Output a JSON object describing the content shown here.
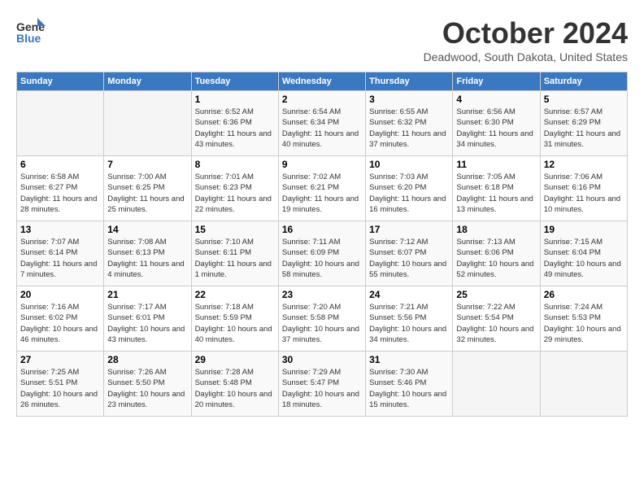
{
  "header": {
    "logo_line1": "General",
    "logo_line2": "Blue",
    "month": "October 2024",
    "location": "Deadwood, South Dakota, United States"
  },
  "weekdays": [
    "Sunday",
    "Monday",
    "Tuesday",
    "Wednesday",
    "Thursday",
    "Friday",
    "Saturday"
  ],
  "weeks": [
    [
      {
        "day": "",
        "empty": true
      },
      {
        "day": "",
        "empty": true
      },
      {
        "day": "1",
        "sunrise": "Sunrise: 6:52 AM",
        "sunset": "Sunset: 6:36 PM",
        "daylight": "Daylight: 11 hours and 43 minutes."
      },
      {
        "day": "2",
        "sunrise": "Sunrise: 6:54 AM",
        "sunset": "Sunset: 6:34 PM",
        "daylight": "Daylight: 11 hours and 40 minutes."
      },
      {
        "day": "3",
        "sunrise": "Sunrise: 6:55 AM",
        "sunset": "Sunset: 6:32 PM",
        "daylight": "Daylight: 11 hours and 37 minutes."
      },
      {
        "day": "4",
        "sunrise": "Sunrise: 6:56 AM",
        "sunset": "Sunset: 6:30 PM",
        "daylight": "Daylight: 11 hours and 34 minutes."
      },
      {
        "day": "5",
        "sunrise": "Sunrise: 6:57 AM",
        "sunset": "Sunset: 6:29 PM",
        "daylight": "Daylight: 11 hours and 31 minutes."
      }
    ],
    [
      {
        "day": "6",
        "sunrise": "Sunrise: 6:58 AM",
        "sunset": "Sunset: 6:27 PM",
        "daylight": "Daylight: 11 hours and 28 minutes."
      },
      {
        "day": "7",
        "sunrise": "Sunrise: 7:00 AM",
        "sunset": "Sunset: 6:25 PM",
        "daylight": "Daylight: 11 hours and 25 minutes."
      },
      {
        "day": "8",
        "sunrise": "Sunrise: 7:01 AM",
        "sunset": "Sunset: 6:23 PM",
        "daylight": "Daylight: 11 hours and 22 minutes."
      },
      {
        "day": "9",
        "sunrise": "Sunrise: 7:02 AM",
        "sunset": "Sunset: 6:21 PM",
        "daylight": "Daylight: 11 hours and 19 minutes."
      },
      {
        "day": "10",
        "sunrise": "Sunrise: 7:03 AM",
        "sunset": "Sunset: 6:20 PM",
        "daylight": "Daylight: 11 hours and 16 minutes."
      },
      {
        "day": "11",
        "sunrise": "Sunrise: 7:05 AM",
        "sunset": "Sunset: 6:18 PM",
        "daylight": "Daylight: 11 hours and 13 minutes."
      },
      {
        "day": "12",
        "sunrise": "Sunrise: 7:06 AM",
        "sunset": "Sunset: 6:16 PM",
        "daylight": "Daylight: 11 hours and 10 minutes."
      }
    ],
    [
      {
        "day": "13",
        "sunrise": "Sunrise: 7:07 AM",
        "sunset": "Sunset: 6:14 PM",
        "daylight": "Daylight: 11 hours and 7 minutes."
      },
      {
        "day": "14",
        "sunrise": "Sunrise: 7:08 AM",
        "sunset": "Sunset: 6:13 PM",
        "daylight": "Daylight: 11 hours and 4 minutes."
      },
      {
        "day": "15",
        "sunrise": "Sunrise: 7:10 AM",
        "sunset": "Sunset: 6:11 PM",
        "daylight": "Daylight: 11 hours and 1 minute."
      },
      {
        "day": "16",
        "sunrise": "Sunrise: 7:11 AM",
        "sunset": "Sunset: 6:09 PM",
        "daylight": "Daylight: 10 hours and 58 minutes."
      },
      {
        "day": "17",
        "sunrise": "Sunrise: 7:12 AM",
        "sunset": "Sunset: 6:07 PM",
        "daylight": "Daylight: 10 hours and 55 minutes."
      },
      {
        "day": "18",
        "sunrise": "Sunrise: 7:13 AM",
        "sunset": "Sunset: 6:06 PM",
        "daylight": "Daylight: 10 hours and 52 minutes."
      },
      {
        "day": "19",
        "sunrise": "Sunrise: 7:15 AM",
        "sunset": "Sunset: 6:04 PM",
        "daylight": "Daylight: 10 hours and 49 minutes."
      }
    ],
    [
      {
        "day": "20",
        "sunrise": "Sunrise: 7:16 AM",
        "sunset": "Sunset: 6:02 PM",
        "daylight": "Daylight: 10 hours and 46 minutes."
      },
      {
        "day": "21",
        "sunrise": "Sunrise: 7:17 AM",
        "sunset": "Sunset: 6:01 PM",
        "daylight": "Daylight: 10 hours and 43 minutes."
      },
      {
        "day": "22",
        "sunrise": "Sunrise: 7:18 AM",
        "sunset": "Sunset: 5:59 PM",
        "daylight": "Daylight: 10 hours and 40 minutes."
      },
      {
        "day": "23",
        "sunrise": "Sunrise: 7:20 AM",
        "sunset": "Sunset: 5:58 PM",
        "daylight": "Daylight: 10 hours and 37 minutes."
      },
      {
        "day": "24",
        "sunrise": "Sunrise: 7:21 AM",
        "sunset": "Sunset: 5:56 PM",
        "daylight": "Daylight: 10 hours and 34 minutes."
      },
      {
        "day": "25",
        "sunrise": "Sunrise: 7:22 AM",
        "sunset": "Sunset: 5:54 PM",
        "daylight": "Daylight: 10 hours and 32 minutes."
      },
      {
        "day": "26",
        "sunrise": "Sunrise: 7:24 AM",
        "sunset": "Sunset: 5:53 PM",
        "daylight": "Daylight: 10 hours and 29 minutes."
      }
    ],
    [
      {
        "day": "27",
        "sunrise": "Sunrise: 7:25 AM",
        "sunset": "Sunset: 5:51 PM",
        "daylight": "Daylight: 10 hours and 26 minutes."
      },
      {
        "day": "28",
        "sunrise": "Sunrise: 7:26 AM",
        "sunset": "Sunset: 5:50 PM",
        "daylight": "Daylight: 10 hours and 23 minutes."
      },
      {
        "day": "29",
        "sunrise": "Sunrise: 7:28 AM",
        "sunset": "Sunset: 5:48 PM",
        "daylight": "Daylight: 10 hours and 20 minutes."
      },
      {
        "day": "30",
        "sunrise": "Sunrise: 7:29 AM",
        "sunset": "Sunset: 5:47 PM",
        "daylight": "Daylight: 10 hours and 18 minutes."
      },
      {
        "day": "31",
        "sunrise": "Sunrise: 7:30 AM",
        "sunset": "Sunset: 5:46 PM",
        "daylight": "Daylight: 10 hours and 15 minutes."
      },
      {
        "day": "",
        "empty": true
      },
      {
        "day": "",
        "empty": true
      }
    ]
  ]
}
